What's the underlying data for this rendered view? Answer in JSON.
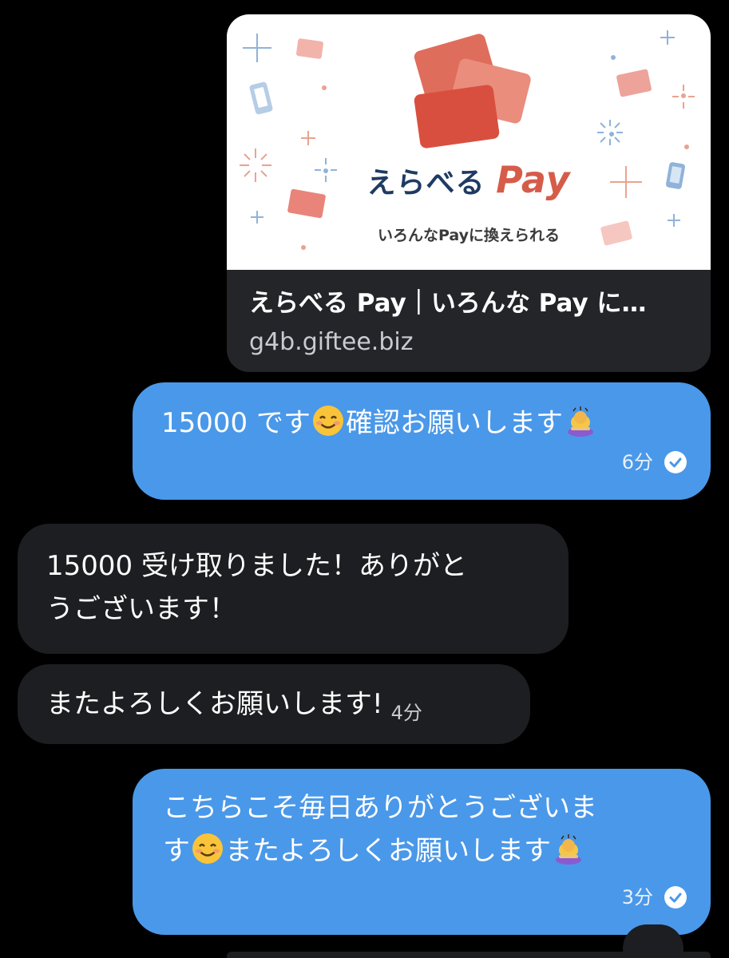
{
  "link_preview": {
    "brand_name": "えらべる",
    "brand_pay": "Pay",
    "tagline": "いろんなPayに換えられる",
    "title": "えらべる Pay｜いろんな Pay に…",
    "domain": "g4b.giftee.biz"
  },
  "messages": [
    {
      "direction": "outgoing",
      "text_before": "15000 です",
      "text_after": "確認お願いします",
      "time": "6分",
      "read": true
    },
    {
      "direction": "incoming",
      "line1": "15000 受け取りました！ありがと",
      "line2": "うございます！"
    },
    {
      "direction": "incoming",
      "text": "またよろしくお願いします!",
      "time": "4分"
    },
    {
      "direction": "outgoing",
      "line1": "こちらこそ毎日ありがとうございま",
      "line2_before": "す",
      "line2_after": "またよろしくお願いします",
      "time": "3分",
      "read": true
    }
  ],
  "colors": {
    "outgoing_bubble": "#4a98e9",
    "incoming_bubble": "#1d1e21",
    "background": "#000000",
    "card_footer": "#232529"
  },
  "icons": [
    "smiling-face-emoji",
    "bowing-woman-emoji",
    "read-check-icon"
  ]
}
